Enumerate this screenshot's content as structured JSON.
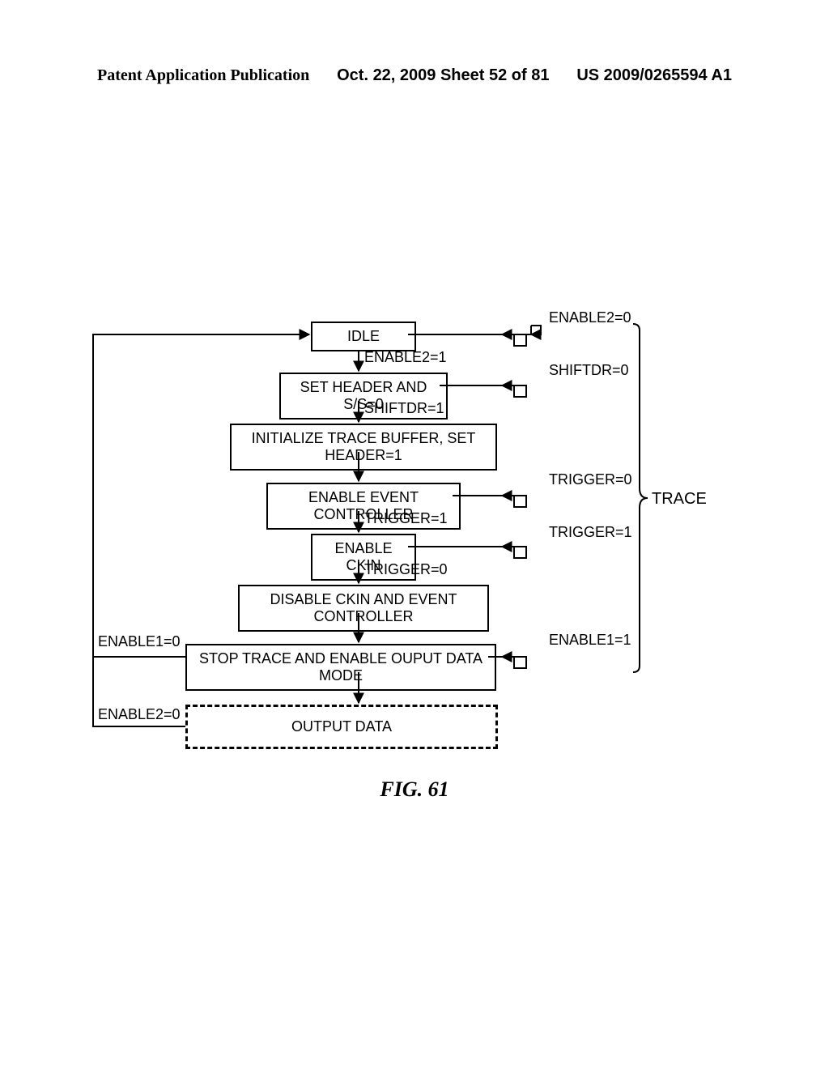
{
  "header": {
    "left": "Patent Application Publication",
    "center": "Oct. 22, 2009  Sheet 52 of 81",
    "right": "US 2009/0265594 A1"
  },
  "figure_title": "FIG. 61",
  "states": {
    "idle": "IDLE",
    "setHeader": "SET HEADER AND S/S=0",
    "initBuffer": "INITIALIZE TRACE BUFFER, SET HEADER=1",
    "enableEvent": "ENABLE EVENT CONTROLLER",
    "enableCkin": "ENABLE CKIN",
    "disableCkin": "DISABLE CKIN AND EVENT CONTROLLER",
    "stopTrace": "STOP TRACE AND ENABLE OUPUT DATA MODE",
    "outputData": "OUTPUT DATA"
  },
  "transitions": {
    "enable2_0": "ENABLE2=0",
    "enable2_1": "ENABLE2=1",
    "shiftdr_0": "SHIFTDR=0",
    "shiftdr_1": "SHIFTDR=1",
    "trigger_0": "TRIGGER=0",
    "trigger_1": "TRIGGER=1",
    "trigger_1b": "TRIGGER=1",
    "trigger_0b": "TRIGGER=0",
    "enable1_0": "ENABLE1=0",
    "enable1_1": "ENABLE1=1",
    "enable2_0b": "ENABLE2=0"
  },
  "group_label": "TRACE"
}
